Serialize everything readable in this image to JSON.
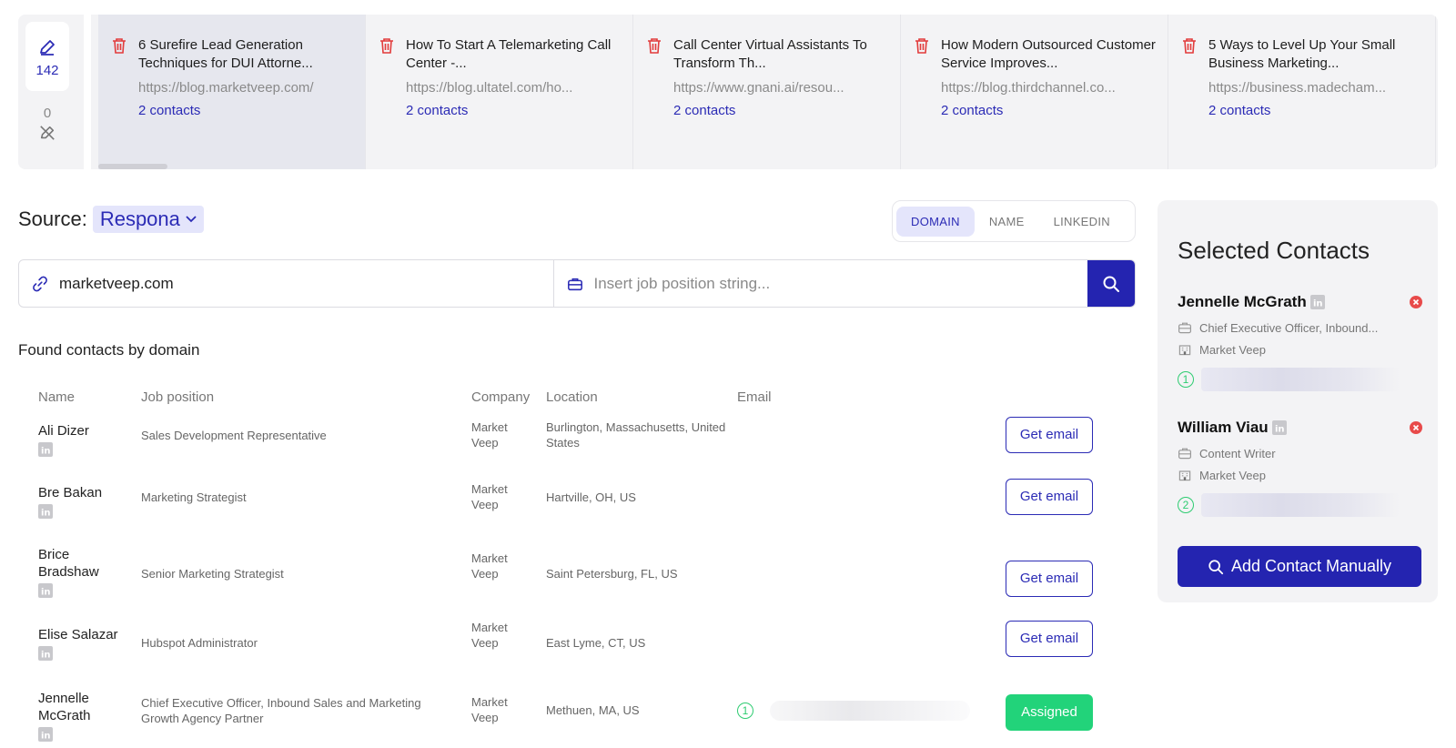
{
  "sidebar_counts": {
    "active": "142",
    "inactive": "0"
  },
  "pages": [
    {
      "title": "6 Surefire Lead Generation Techniques for DUI Attorne...",
      "url": "https://blog.marketveep.com/",
      "contacts": "2 contacts"
    },
    {
      "title": "How To Start A Telemarketing Call Center -...",
      "url": "https://blog.ultatel.com/ho...",
      "contacts": "2 contacts"
    },
    {
      "title": "Call Center Virtual Assistants To Transform Th...",
      "url": "https://www.gnani.ai/resou...",
      "contacts": "2 contacts"
    },
    {
      "title": "How Modern Outsourced Customer Service Improves...",
      "url": "https://blog.thirdchannel.co...",
      "contacts": "2 contacts"
    },
    {
      "title": "5 Ways to Level Up Your Small Business Marketing...",
      "url": "https://business.madecham...",
      "contacts": "2 contacts"
    }
  ],
  "source": {
    "label": "Source:",
    "value": "Respona"
  },
  "tabs": [
    "DOMAIN",
    "NAME",
    "LINKEDIN"
  ],
  "search": {
    "domain_value": "marketveep.com",
    "job_placeholder": "Insert job position string..."
  },
  "found_heading": "Found contacts by domain",
  "columns": [
    "Name",
    "Job position",
    "Company",
    "Location",
    "Email"
  ],
  "rows": [
    {
      "name": "Ali Dizer",
      "job": "Sales Development Representative",
      "company": "Market Veep",
      "location": "Burlington, Massachusetts, United States",
      "action": "Get email"
    },
    {
      "name": "Bre Bakan",
      "job": "Marketing Strategist",
      "company": "Market Veep",
      "location": "Hartville, OH, US",
      "action": "Get email"
    },
    {
      "name": "Brice Bradshaw",
      "job": "Senior Marketing Strategist",
      "company": "Market Veep",
      "location": "Saint Petersburg, FL, US",
      "action": "Get email"
    },
    {
      "name": "Elise Salazar",
      "job": "Hubspot Administrator",
      "company": "Market Veep",
      "location": "East Lyme, CT, US",
      "action": "Get email"
    },
    {
      "name": "Jennelle McGrath",
      "job": "Chief Executive Officer, Inbound Sales and Marketing Growth Agency Partner",
      "company": "Market Veep",
      "location": "Methuen, MA, US",
      "email_index": "1",
      "action": "Assigned"
    }
  ],
  "panel": {
    "title": "Selected Contacts",
    "contacts": [
      {
        "name": "Jennelle McGrath",
        "position": "Chief Executive Officer, Inbound...",
        "company": "Market Veep",
        "index": "1"
      },
      {
        "name": "William Viau",
        "position": "Content Writer",
        "company": "Market Veep",
        "index": "2"
      }
    ],
    "add_button": "Add Contact Manually"
  },
  "colors": {
    "accent": "#2424b0",
    "assigned": "#22d37a",
    "trash": "#e23b3b"
  }
}
